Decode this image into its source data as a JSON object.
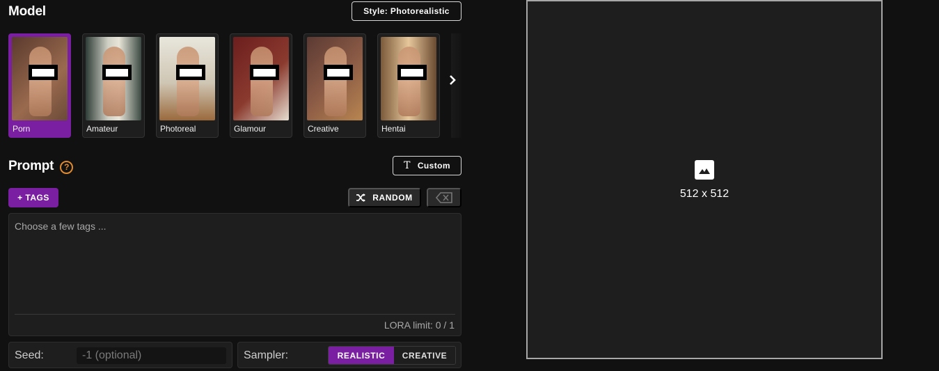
{
  "model": {
    "title": "Model",
    "style_button": "Style: Photorealistic",
    "cards": [
      {
        "label": "Porn",
        "selected": true
      },
      {
        "label": "Amateur",
        "selected": false
      },
      {
        "label": "Photoreal",
        "selected": false
      },
      {
        "label": "Glamour",
        "selected": false
      },
      {
        "label": "Creative",
        "selected": false
      },
      {
        "label": "Hentai",
        "selected": false
      }
    ],
    "next_icon": "chevron-right-icon"
  },
  "prompt": {
    "title": "Prompt",
    "help_icon": "?",
    "custom_button": "Custom",
    "custom_icon": "T",
    "tags_button": "+ TAGS",
    "random_button": "RANDOM",
    "placeholder": "Choose a few tags ...",
    "value": "",
    "lora_limit": "LORA limit: 0 / 1"
  },
  "seed": {
    "label": "Seed:",
    "placeholder": "-1 (optional)",
    "value": ""
  },
  "sampler": {
    "label": "Sampler:",
    "options": [
      "REALISTIC",
      "CREATIVE"
    ],
    "selected": "REALISTIC"
  },
  "preview": {
    "icon": "image-icon",
    "size": "512 x 512"
  },
  "colors": {
    "accent": "#7b1fa2",
    "help": "#e08a2e",
    "background": "#111111",
    "panel": "#1e1e1e"
  }
}
